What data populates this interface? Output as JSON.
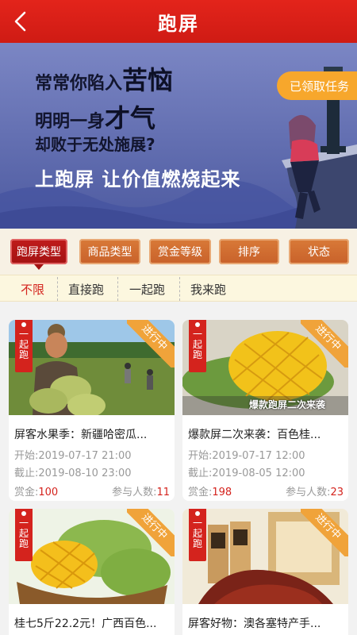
{
  "header": {
    "title": "跑屏"
  },
  "banner": {
    "line1_a": "常常你陷入",
    "line1_b": "苦恼",
    "line2_a": "明明一身",
    "line2_b": "才气",
    "line3": "却败于无处施展?",
    "line4": "上跑屏  让价值燃烧起来",
    "task_button": "已领取任务"
  },
  "filters": [
    "跑屏类型",
    "商品类型",
    "赏金等级",
    "排序",
    "状态"
  ],
  "subtabs": [
    "不限",
    "直接跑",
    "一起跑",
    "我来跑"
  ],
  "labels": {
    "start": "开始:",
    "end": "截止:",
    "bounty": "赏金:",
    "participants": "参与人数:"
  },
  "cards": [
    {
      "tag": "一起跑",
      "status": "进行中",
      "title": "屏客水果季：新疆哈密瓜...",
      "start": "2019-07-17 21:00",
      "end": "2019-08-10 23:00",
      "bounty": "100",
      "participants": "11"
    },
    {
      "tag": "一起跑",
      "status": "进行中",
      "title": "爆款屏二次来袭：百色桂...",
      "overlay": "爆款跑屏二次来袭",
      "start": "2019-07-17 12:00",
      "end": "2019-08-05 12:00",
      "bounty": "198",
      "participants": "23"
    },
    {
      "tag": "一起跑",
      "status": "进行中",
      "title": "桂七5斤22.2元！广西百色..."
    },
    {
      "tag": "一起跑",
      "status": "进行中",
      "title": "屏客好物：澳各塞特产手..."
    }
  ],
  "colors": {
    "primary_red": "#d4231d",
    "tab_orange": "#c8612a",
    "ribbon": "#f0a33a",
    "banner_bg": "#5e6db0"
  }
}
